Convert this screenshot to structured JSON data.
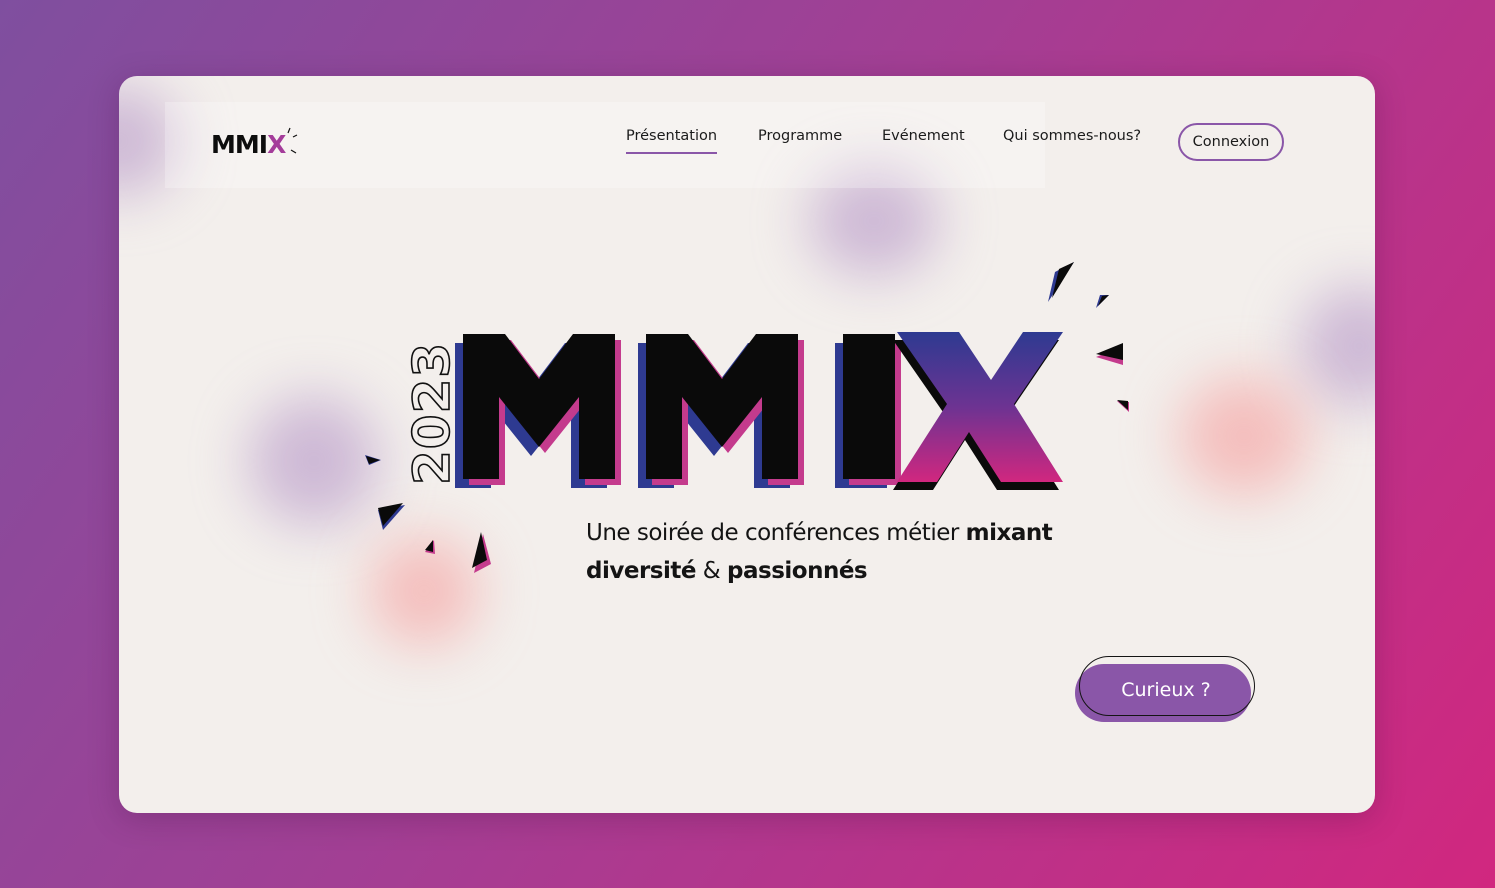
{
  "colors": {
    "accent": "#8a56a8",
    "brand_pink": "#d1277f",
    "brand_blue": "#2e3a91",
    "card_bg": "#f3efec"
  },
  "brand": {
    "logo_text": "MMI",
    "logo_accent": "X"
  },
  "nav": {
    "items": [
      {
        "label": "Présentation",
        "active": true
      },
      {
        "label": "Programme",
        "active": false
      },
      {
        "label": "Evénement",
        "active": false
      },
      {
        "label": "Qui sommes-nous?",
        "active": false
      }
    ],
    "login_label": "Connexion"
  },
  "hero": {
    "year": "2023",
    "title_letters": [
      "M",
      "M",
      "I",
      "X"
    ],
    "tagline_part1": "Une soirée de conférences métier",
    "tagline_bold1": "mixant",
    "tagline_bold2": "diversité",
    "tagline_amp": "&",
    "tagline_bold3": "passionnés",
    "cta_label": "Curieux ?"
  }
}
